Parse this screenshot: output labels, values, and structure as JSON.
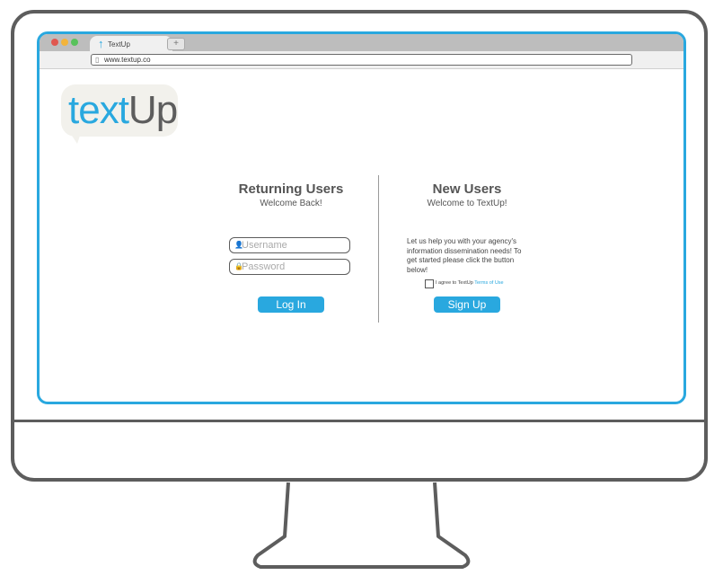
{
  "browser": {
    "tab": {
      "label": "TextUp",
      "icon": "arrow-up-icon"
    },
    "new_tab": "+",
    "address": "www.textup.co",
    "window_controls": [
      "#e0574f",
      "#f3b43b",
      "#58c25b"
    ]
  },
  "logo": {
    "part1": "text",
    "part2": "Up"
  },
  "returning": {
    "title": "Returning Users",
    "subtitle": "Welcome Back!",
    "username_placeholder": "Username",
    "password_placeholder": "Password",
    "login_label": "Log In"
  },
  "new_users": {
    "title": "New Users",
    "subtitle": "Welcome to TextUp!",
    "description": "Let us help you with your agency's information dissemination needs! To get started please click the button below!",
    "agree_text": "I agree to TextUp ",
    "terms_link": "Terms of Use",
    "signup_label": "Sign Up"
  },
  "colors": {
    "accent": "#29a8df",
    "frame": "#5d5d5d"
  }
}
